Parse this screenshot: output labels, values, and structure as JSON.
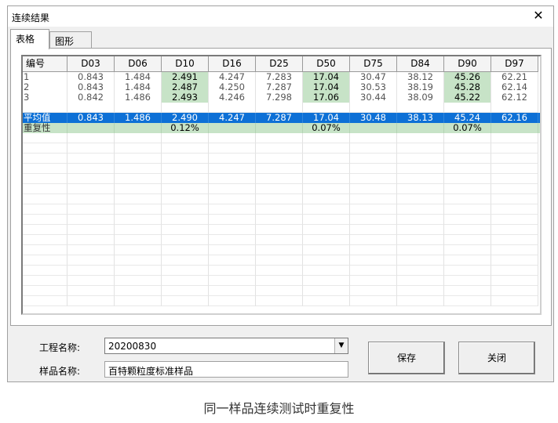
{
  "window": {
    "title": "连续结果",
    "close_glyph": "✕"
  },
  "tabs": [
    {
      "label": "表格"
    },
    {
      "label": "图形"
    }
  ],
  "table": {
    "headers": [
      "编号",
      "D03",
      "D06",
      "D10",
      "D16",
      "D25",
      "D50",
      "D75",
      "D84",
      "D90",
      "D97"
    ],
    "rows": [
      [
        "1",
        "0.843",
        "1.484",
        "2.491",
        "4.247",
        "7.283",
        "17.04",
        "30.47",
        "38.12",
        "45.26",
        "62.21"
      ],
      [
        "2",
        "0.843",
        "1.484",
        "2.487",
        "4.250",
        "7.287",
        "17.04",
        "30.53",
        "38.19",
        "45.28",
        "62.14"
      ],
      [
        "3",
        "0.842",
        "1.486",
        "2.493",
        "4.246",
        "7.298",
        "17.06",
        "30.44",
        "38.09",
        "45.22",
        "62.12"
      ]
    ],
    "average": [
      "平均值",
      "0.843",
      "1.486",
      "2.490",
      "4.247",
      "7.287",
      "17.04",
      "30.48",
      "38.13",
      "45.24",
      "62.16"
    ],
    "repeatability": [
      "重复性",
      "",
      "",
      "0.12%",
      "",
      "",
      "0.07%",
      "",
      "",
      "0.07%",
      ""
    ],
    "highlight_columns": [
      "D10",
      "D50",
      "D90"
    ],
    "colors": {
      "selection": "#0d70d6",
      "highlight": "#c7e3c7"
    }
  },
  "form": {
    "project_label": "工程名称:",
    "project_value": "20200830",
    "sample_label": "样品名称:",
    "sample_value": "百特颗粒度标准样品"
  },
  "buttons": {
    "save": "保存",
    "close": "关闭"
  },
  "caption": "同一样品连续测试时重复性"
}
